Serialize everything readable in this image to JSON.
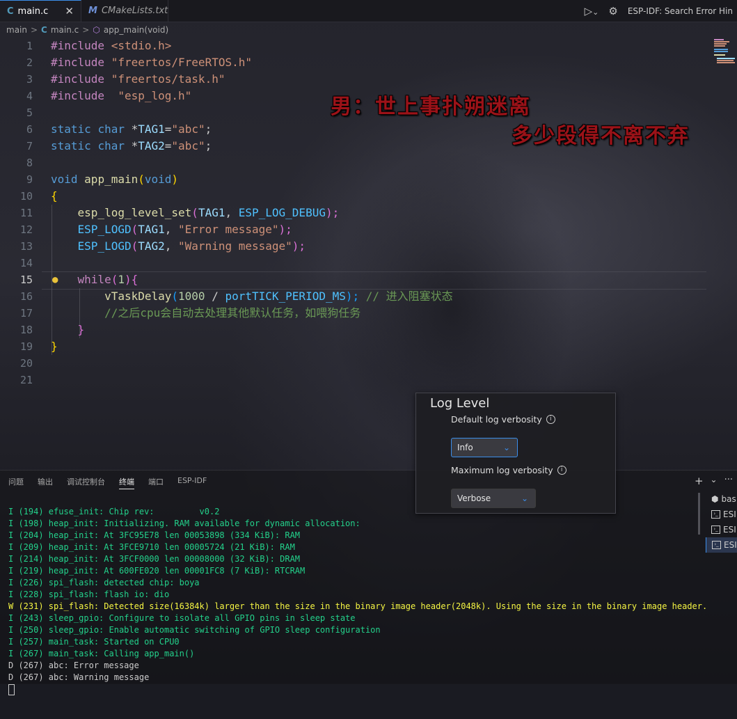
{
  "tabs": [
    {
      "icon": "C",
      "label": "main.c",
      "close": "✕"
    },
    {
      "icon": "M",
      "label": "CMakeLists.txt"
    }
  ],
  "title_actions": {
    "run": "▷",
    "chevron": "⌄",
    "gear": "⚙",
    "extension_label": "ESP-IDF: Search Error Hin"
  },
  "breadcrumb": {
    "folder": "main",
    "file_icon": "C",
    "file": "main.c",
    "symbol_icon": "⬡",
    "symbol": "app_main(void)",
    "separator": ">"
  },
  "editor": {
    "line_numbers": [
      "1",
      "2",
      "3",
      "4",
      "5",
      "6",
      "7",
      "8",
      "9",
      "10",
      "11",
      "12",
      "13",
      "14",
      "15",
      "16",
      "17",
      "18",
      "19",
      "20",
      "21"
    ],
    "current_line": "15",
    "code": {
      "l1": {
        "kw": "#include",
        "arg": "<stdio.h>"
      },
      "l2": {
        "kw": "#include",
        "arg": "\"freertos/FreeRTOS.h\""
      },
      "l3": {
        "kw": "#include",
        "arg": "\"freertos/task.h\""
      },
      "l4": {
        "kw": "#include",
        "arg": " \"esp_log.h\""
      },
      "l6": {
        "kw": "static",
        "ty": "char",
        "ptr": "*",
        "id": "TAG1",
        "eq": "=",
        "str": "\"abc\"",
        "semi": ";"
      },
      "l7": {
        "kw": "static",
        "ty": "char",
        "ptr": "*",
        "id": "TAG2",
        "eq": "=",
        "str": "\"abc\"",
        "semi": ";"
      },
      "l9": {
        "ty": "void",
        "fn": "app_main",
        "open": "(",
        "arg": "void",
        "close": ")"
      },
      "l10": {
        "brace": "{"
      },
      "l11": {
        "fn": "esp_log_level_set",
        "open": "(",
        "a1": "TAG1",
        "comma": ", ",
        "a2": "ESP_LOG_DEBUG",
        "close": ");"
      },
      "l12": {
        "fn": "ESP_LOGD",
        "open": "(",
        "a1": "TAG1",
        "comma": ", ",
        "str": "\"Error message\"",
        "close": ");"
      },
      "l13": {
        "fn": "ESP_LOGD",
        "open": "(",
        "a1": "TAG2",
        "comma": ", ",
        "str": "\"Warning message\"",
        "close": ");"
      },
      "l15": {
        "kw": "while",
        "open": "(",
        "num": "1",
        "close": "){"
      },
      "l16": {
        "fn": "vTaskDelay",
        "open": "(",
        "num": "1000",
        "op": " / ",
        "mac": "portTICK_PERIOD_MS",
        "close": ");",
        "comment": " // 进入阻塞状态"
      },
      "l17": {
        "comment": "//之后cpu会自动去处理其他默认任务，如喂狗任务"
      },
      "l18": {
        "brace": "}"
      },
      "l19": {
        "brace": "}"
      }
    }
  },
  "overlay_lyrics": {
    "line1": "男：世上事扑朔迷离",
    "line2": "多少段得不离不弃"
  },
  "panel": {
    "tabs": [
      "问题",
      "输出",
      "调试控制台",
      "终端",
      "端口",
      "ESP-IDF"
    ],
    "actions": {
      "add": "+",
      "more": "⌄",
      "ellipsis": "···"
    },
    "terminal_lines": [
      {
        "level": "I",
        "text": "I (194) efuse_init: Chip rev:         v0.2"
      },
      {
        "level": "I",
        "text": "I (198) heap_init: Initializing. RAM available for dynamic allocation:"
      },
      {
        "level": "I",
        "text": "I (204) heap_init: At 3FC95E78 len 00053898 (334 KiB): RAM"
      },
      {
        "level": "I",
        "text": "I (209) heap_init: At 3FCE9710 len 00005724 (21 KiB): RAM"
      },
      {
        "level": "I",
        "text": "I (214) heap_init: At 3FCF0000 len 00008000 (32 KiB): DRAM"
      },
      {
        "level": "I",
        "text": "I (219) heap_init: At 600FE020 len 00001FC8 (7 KiB): RTCRAM"
      },
      {
        "level": "I",
        "text": "I (226) spi_flash: detected chip: boya"
      },
      {
        "level": "I",
        "text": "I (228) spi_flash: flash io: dio"
      },
      {
        "level": "W",
        "text": "W (231) spi_flash: Detected size(16384k) larger than the size in the binary image header(2048k). Using the size in the binary image header."
      },
      {
        "level": "I",
        "text": "I (243) sleep_gpio: Configure to isolate all GPIO pins in sleep state"
      },
      {
        "level": "I",
        "text": "I (250) sleep_gpio: Enable automatic switching of GPIO sleep configuration"
      },
      {
        "level": "I",
        "text": "I (257) main_task: Started on CPU0"
      },
      {
        "level": "I",
        "text": "I (267) main_task: Calling app_main()"
      },
      {
        "level": "D",
        "text": "D (267) abc: Error message"
      },
      {
        "level": "D",
        "text": "D (267) abc: Warning message"
      }
    ],
    "terminal_list": [
      {
        "label": "bas",
        "icon": "⬢"
      },
      {
        "label": "ESI",
        "icon": "›_"
      },
      {
        "label": "ESI",
        "icon": "›_"
      },
      {
        "label": "ESI",
        "icon": "›_",
        "selected": true
      }
    ]
  },
  "log_level_popup": {
    "title": "Log Level",
    "default_label": "Default log verbosity",
    "default_value": "Info",
    "max_label": "Maximum log verbosity",
    "max_value": "Verbose",
    "info_icon": "i",
    "chevron": "⌄"
  },
  "colors": {
    "accent": "#3b8eea",
    "info_text": "#23d18b",
    "warn_text": "#f5f543",
    "lyric": "#9b1218"
  }
}
